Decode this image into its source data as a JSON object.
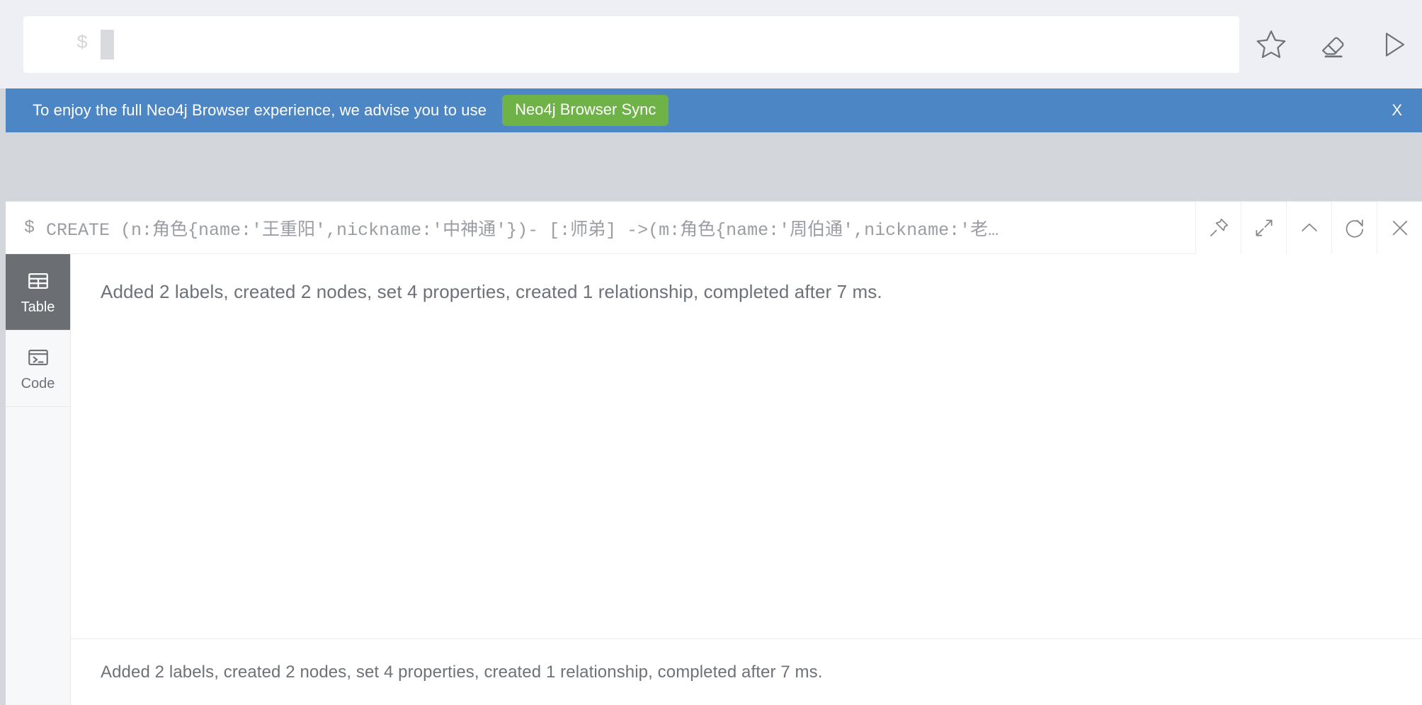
{
  "editor": {
    "prompt": "$",
    "value": "",
    "placeholder": "",
    "actions": [
      {
        "name": "favorite-icon",
        "label": "Favorite"
      },
      {
        "name": "eraser-icon",
        "label": "Clear"
      },
      {
        "name": "play-icon",
        "label": "Run"
      }
    ]
  },
  "banner": {
    "message": "To enjoy the full Neo4j Browser experience, we advise you to use",
    "badge_label": "Neo4j Browser Sync",
    "close_label": "X",
    "background_color": "#4d86c4",
    "badge_color": "#6eb248"
  },
  "frame": {
    "prompt": "$",
    "query": "CREATE (n:角色{name:'王重阳',nickname:'中神通'})- [:师弟] ->(m:角色{name:'周伯通',nickname:'老…",
    "tools": [
      {
        "name": "pin-icon",
        "label": "Pin"
      },
      {
        "name": "expand-icon",
        "label": "Fullscreen"
      },
      {
        "name": "chevron-up-icon",
        "label": "Collapse"
      },
      {
        "name": "refresh-icon",
        "label": "Rerun"
      },
      {
        "name": "close-icon",
        "label": "Close"
      }
    ],
    "views": [
      {
        "name": "table",
        "label": "Table",
        "icon": "table-icon",
        "active": true
      },
      {
        "name": "code",
        "label": "Code",
        "icon": "code-icon",
        "active": false
      }
    ],
    "result_message": "Added 2 labels, created 2 nodes, set 4 properties, created 1 relationship, completed after 7 ms.",
    "status_message": "Added 2 labels, created 2 nodes, set 4 properties, created 1 relationship, completed after 7 ms."
  }
}
